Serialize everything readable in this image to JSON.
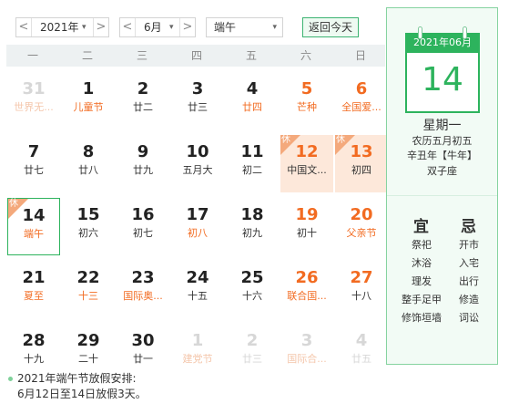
{
  "controls": {
    "year_value": "2021年",
    "month_value": "6月",
    "holiday_value": "端午",
    "today_label": "返回今天",
    "prev_arrow": "<",
    "next_arrow": ">",
    "caret": "▾"
  },
  "weekdays": [
    "一",
    "二",
    "三",
    "四",
    "五",
    "六",
    "日"
  ],
  "weeks": [
    [
      {
        "day": "31",
        "lunar": "世界无...",
        "other": true,
        "festive": true
      },
      {
        "day": "1",
        "lunar": "儿童节",
        "festive": true
      },
      {
        "day": "2",
        "lunar": "廿二"
      },
      {
        "day": "3",
        "lunar": "廿三"
      },
      {
        "day": "4",
        "lunar": "廿四",
        "festive": true
      },
      {
        "day": "5",
        "lunar": "芒种",
        "weekend": true,
        "festive": true
      },
      {
        "day": "6",
        "lunar": "全国爱...",
        "weekend": true,
        "festive": true
      }
    ],
    [
      {
        "day": "7",
        "lunar": "廿七"
      },
      {
        "day": "8",
        "lunar": "廿八"
      },
      {
        "day": "9",
        "lunar": "廿九"
      },
      {
        "day": "10",
        "lunar": "五月大"
      },
      {
        "day": "11",
        "lunar": "初二"
      },
      {
        "day": "12",
        "lunar": "中国文...",
        "weekend": true,
        "holiday": true,
        "badge": "休"
      },
      {
        "day": "13",
        "lunar": "初四",
        "weekend": true,
        "holiday": true,
        "badge": "休"
      }
    ],
    [
      {
        "day": "14",
        "lunar": "端午",
        "festive": true,
        "selected": true,
        "badge": "休"
      },
      {
        "day": "15",
        "lunar": "初六"
      },
      {
        "day": "16",
        "lunar": "初七"
      },
      {
        "day": "17",
        "lunar": "初八",
        "festive": true
      },
      {
        "day": "18",
        "lunar": "初九"
      },
      {
        "day": "19",
        "lunar": "初十",
        "weekend": true
      },
      {
        "day": "20",
        "lunar": "父亲节",
        "weekend": true,
        "festive": true
      }
    ],
    [
      {
        "day": "21",
        "lunar": "夏至",
        "festive": true
      },
      {
        "day": "22",
        "lunar": "十三",
        "festive": true
      },
      {
        "day": "23",
        "lunar": "国际奥...",
        "festive": true
      },
      {
        "day": "24",
        "lunar": "十五"
      },
      {
        "day": "25",
        "lunar": "十六"
      },
      {
        "day": "26",
        "lunar": "联合国...",
        "weekend": true,
        "festive": true
      },
      {
        "day": "27",
        "lunar": "十八",
        "weekend": true
      }
    ],
    [
      {
        "day": "28",
        "lunar": "十九"
      },
      {
        "day": "29",
        "lunar": "二十"
      },
      {
        "day": "30",
        "lunar": "廿一"
      },
      {
        "day": "1",
        "lunar": "建党节",
        "other": true,
        "festive": true
      },
      {
        "day": "2",
        "lunar": "廿三",
        "other": true
      },
      {
        "day": "3",
        "lunar": "国际合...",
        "other": true,
        "weekend": true,
        "festive": true
      },
      {
        "day": "4",
        "lunar": "廿五",
        "other": true,
        "weekend": true
      }
    ]
  ],
  "side": {
    "card_header": "2021年06月",
    "big_day": "14",
    "weekday": "星期一",
    "lunar": "农历五月初五",
    "ganzhi": "辛丑年【牛年】",
    "zodiac": "双子座",
    "yi_title": "宜",
    "ji_title": "忌",
    "yi_items": [
      "祭祀",
      "沐浴",
      "理发",
      "整手足甲",
      "修饰垣墙"
    ],
    "ji_items": [
      "开市",
      "入宅",
      "出行",
      "修造",
      "词讼"
    ]
  },
  "note": {
    "line1": "2021年端午节放假安排:",
    "line2": "6月12日至14日放假3天。"
  },
  "colors": {
    "accent_green": "#2db35d",
    "festival_orange": "#f26b21",
    "holiday_bg": "#fde8da"
  }
}
